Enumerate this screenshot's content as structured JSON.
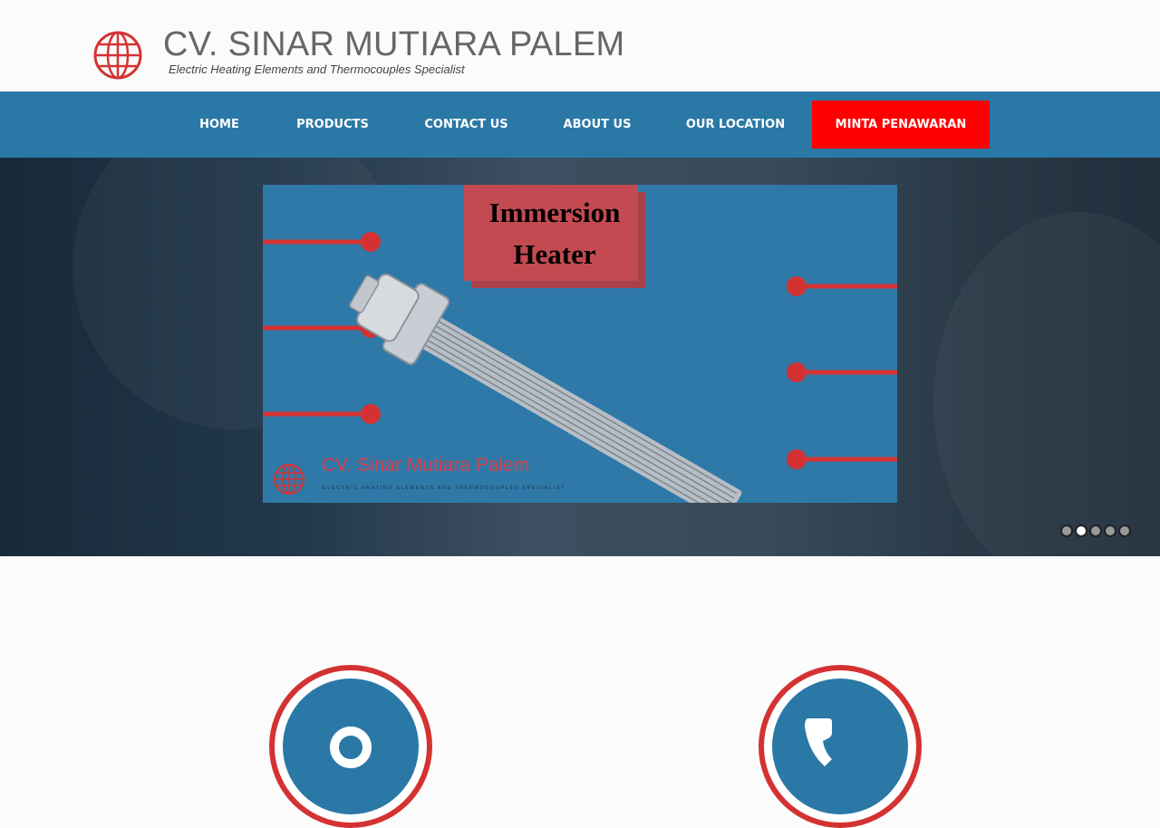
{
  "header": {
    "brand_name": "CV. SINAR MUTIARA PALEM",
    "tagline": "Electric Heating Elements and Thermocouples Specialist",
    "logo_icon": "globe-icon"
  },
  "nav": {
    "items": [
      {
        "label": "HOME"
      },
      {
        "label": "PRODUCTS"
      },
      {
        "label": "CONTACT US"
      },
      {
        "label": "ABOUT US"
      },
      {
        "label": "OUR LOCATION"
      }
    ],
    "cta_label": "MINTA PENAWARAN",
    "cta_color": "#ff0000",
    "bar_color": "#2a78a6"
  },
  "slider": {
    "slide": {
      "title_line1": "Immersion",
      "title_line2": "Heater",
      "brand": "CV. Sinar Mutiara Palem",
      "brand_tagline": "ELECTRIC HEATING ELEMENTS AND THERMOCOUPLES SPECIALIST"
    },
    "dot_count": 5,
    "active_dot": 2
  },
  "features": [
    {
      "icon": "location-pin-icon"
    },
    {
      "icon": "phone-icon"
    }
  ]
}
